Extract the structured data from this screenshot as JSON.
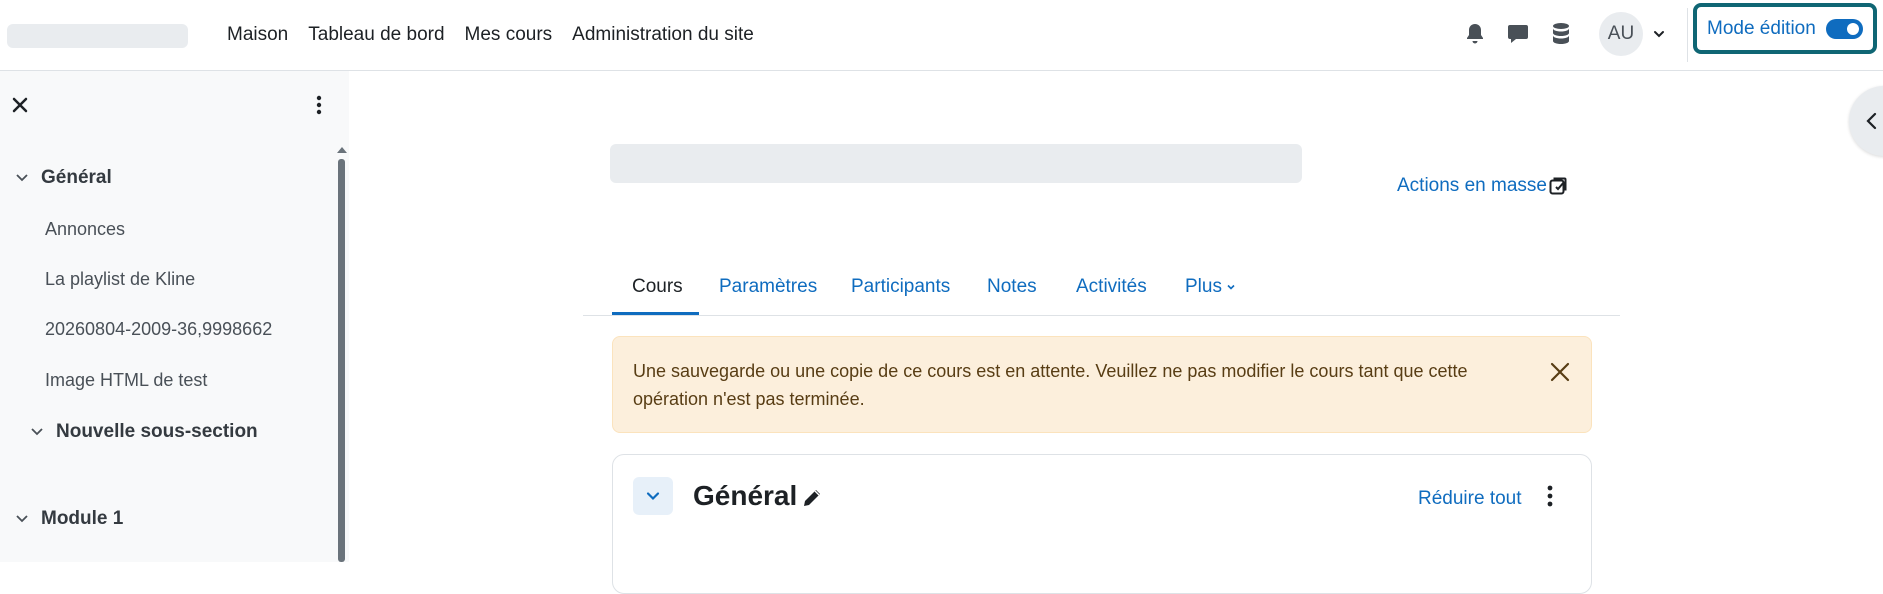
{
  "navbar": {
    "primary": [
      "Maison",
      "Tableau de bord",
      "Mes cours",
      "Administration du site"
    ],
    "icons": [
      "bell-icon",
      "chat-icon",
      "database-icon"
    ],
    "user_initials": "AU",
    "edit_mode_label": "Mode édition",
    "edit_mode_on": true
  },
  "drawer": {
    "items": [
      {
        "type": "section",
        "label": "Général"
      },
      {
        "type": "activity",
        "label": "Annonces"
      },
      {
        "type": "activity",
        "label": "La playlist de Kline"
      },
      {
        "type": "activity",
        "label": "20260804-2009-36,9998662"
      },
      {
        "type": "activity",
        "label": "Image HTML de test"
      },
      {
        "type": "subsection",
        "label": "Nouvelle sous-section"
      },
      {
        "type": "section",
        "label": "Module 1"
      }
    ]
  },
  "main": {
    "bulk_actions": "Actions en masse",
    "tabs": [
      "Cours",
      "Paramètres",
      "Participants",
      "Notes",
      "Activités",
      "Plus"
    ],
    "active_tab": "Cours",
    "alert_text": "Une sauvegarde ou une copie de ce cours est en attente. Veuillez ne pas modifier le cours tant que cette opération n'est pas terminée.",
    "section_title": "Général",
    "collapse_all": "Réduire tout"
  },
  "colors": {
    "accent": "#0f6cbf",
    "edit_mode_border": "#0f6674",
    "alert_bg": "#fcefdc",
    "drawer_bg": "#f8f9fa"
  }
}
